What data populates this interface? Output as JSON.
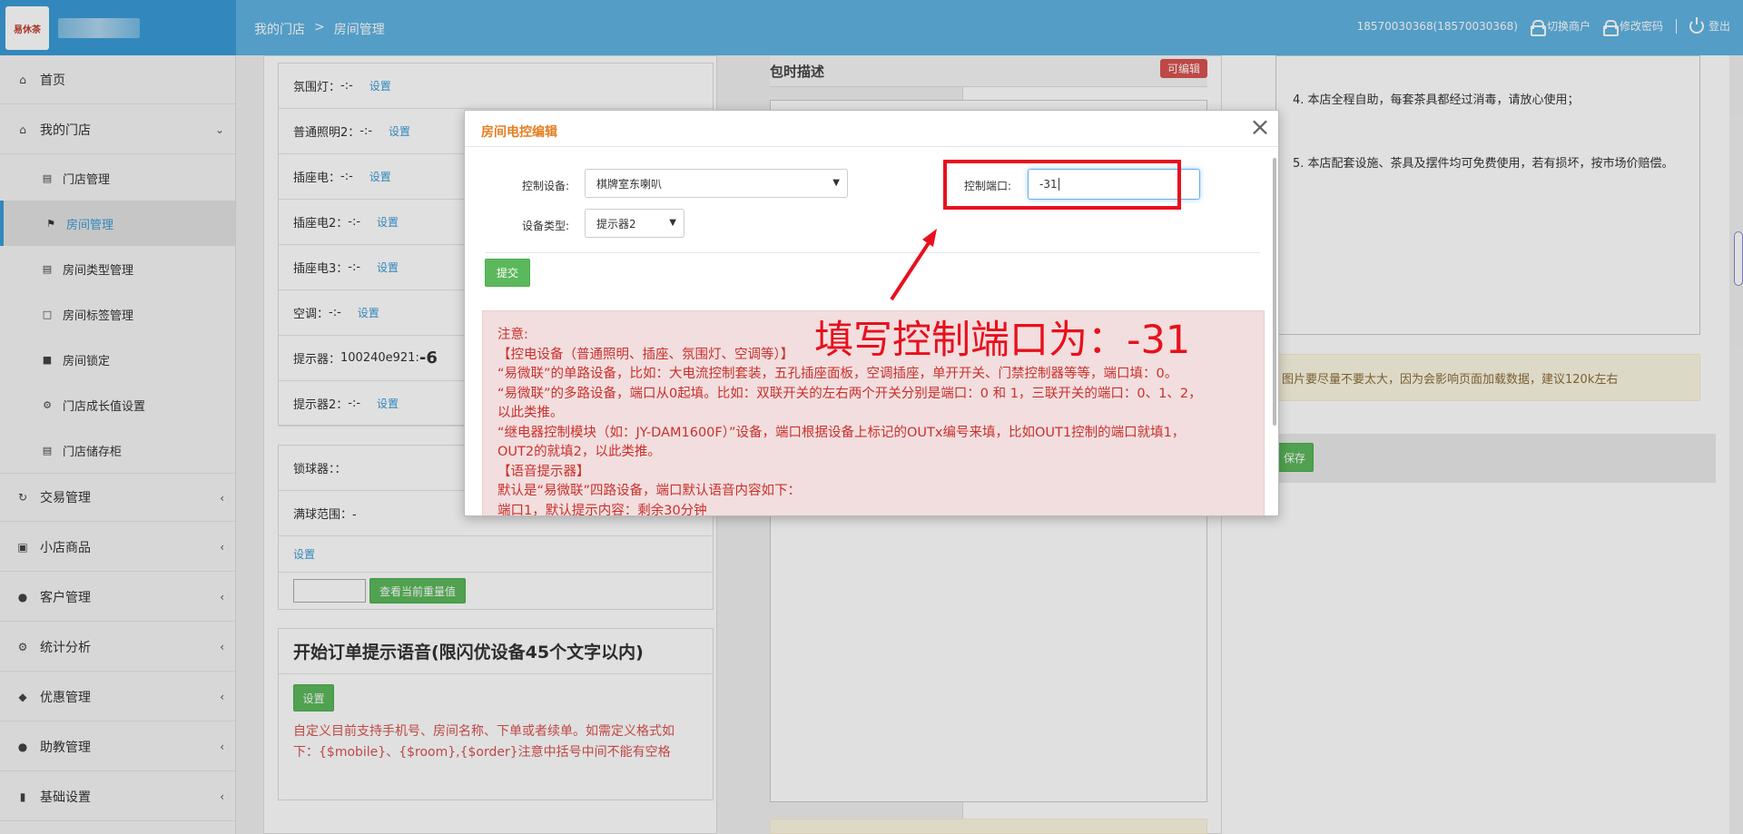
{
  "header": {
    "logo_text": "易休茶",
    "breadcrumb": [
      "我的门店",
      ">",
      "房间管理"
    ],
    "user": "18570030368(18570030368)",
    "switch_merchant": "切换商户",
    "change_password": "修改密码",
    "logout": "登出"
  },
  "sidebar": {
    "items": [
      {
        "label": "首页",
        "icon": "home-icon"
      },
      {
        "label": "我的门店",
        "icon": "home-icon",
        "expanded": true
      },
      {
        "label": "门店管理",
        "icon": "store-icon"
      },
      {
        "label": "房间管理",
        "icon": "flag-icon",
        "active": true
      },
      {
        "label": "房间类型管理",
        "icon": "list-icon"
      },
      {
        "label": "房间标签管理",
        "icon": "bookmark-icon"
      },
      {
        "label": "房间锁定",
        "icon": "lock-icon"
      },
      {
        "label": "门店成长值设置",
        "icon": "gear-icon"
      },
      {
        "label": "门店储存柜",
        "icon": "store-icon"
      },
      {
        "label": "交易管理",
        "icon": "refresh-icon"
      },
      {
        "label": "小店商品",
        "icon": "gift-icon"
      },
      {
        "label": "客户管理",
        "icon": "user-icon"
      },
      {
        "label": "统计分析",
        "icon": "gear-icon"
      },
      {
        "label": "优惠管理",
        "icon": "tags-icon"
      },
      {
        "label": "助教管理",
        "icon": "user-icon"
      },
      {
        "label": "基础设置",
        "icon": "barcode-icon"
      }
    ]
  },
  "devices": {
    "link": "设置",
    "rows": [
      {
        "label": "氛围灯：",
        "value": "-:-"
      },
      {
        "label": "普通照明2：",
        "value": "-:-"
      },
      {
        "label": "插座电：",
        "value": "-:-"
      },
      {
        "label": "插座电2：",
        "value": "-:-"
      },
      {
        "label": "插座电3：",
        "value": "-:-"
      },
      {
        "label": "空调：",
        "value": "-:-"
      },
      {
        "label": "提示器：",
        "value": "100240e921:",
        "big": "-6"
      },
      {
        "label": "提示器2：",
        "value": "-:-"
      }
    ]
  },
  "weight": {
    "lock_label": "锁球器：：",
    "range_label": "满球范围：-",
    "set_link": "设置",
    "query_button": "查看当前重量值"
  },
  "voice": {
    "title": "开始订单提示语音(限闪优设备45个文字以内)",
    "set_button": "设置",
    "note": "自定义目前支持手机号、房间名称、下单或者续单。如需定义格式如下：{$mobile}、{$room},{$order}注意中括号中间不能有空格"
  },
  "description": {
    "title": "包时描述",
    "badge": "可编辑"
  },
  "rules": {
    "line4": "4. 本店全程自助，每套茶具都经过消毒，请放心使用；",
    "line5": "5. 本店配套设施、茶具及摆件均可免费使用，若有损坏，按市场价赔偿。"
  },
  "image_tip": "图片要尽量不要太大，因为会影响页面加载数据，建议120k左右",
  "save_button": "保存",
  "modal": {
    "title": "房间电控编辑",
    "device_label": "控制设备:",
    "device_value": "棋牌室东喇叭",
    "type_label": "设备类型:",
    "type_value": "提示器2",
    "port_label": "控制端口:",
    "port_value": "-31",
    "submit": "提交",
    "notice": [
      "注意:",
      "【控电设备（普通照明、插座、氛围灯、空调等）】",
      "“易微联”的单路设备，比如：大电流控制套装，五孔插座面板，空调插座，单开开关、门禁控制器等等，端口填：0。",
      "“易微联”的多路设备，端口从0起填。比如：双联开关的左右两个开关分别是端口：0 和 1，三联开关的端口：0、1、2，",
      "以此类推。",
      "“继电器控制模块（如：JY-DAM1600F）”设备，端口根据设备上标记的OUTx编号来填，比如OUT1控制的端口就填1，",
      "OUT2的就填2，以此类推。",
      "【语音提示器】",
      "默认是“易微联”四路设备，端口默认语音内容如下：",
      "端口1，默认提示内容：剩余30分钟"
    ]
  },
  "annotation": "填写控制端口为：-31",
  "colors": {
    "topbar": "#5fb3e2",
    "brand": "#3a9bd6",
    "highlight": "#e8101e",
    "notice_text": "#c9302c",
    "green": "#5cb85c"
  }
}
